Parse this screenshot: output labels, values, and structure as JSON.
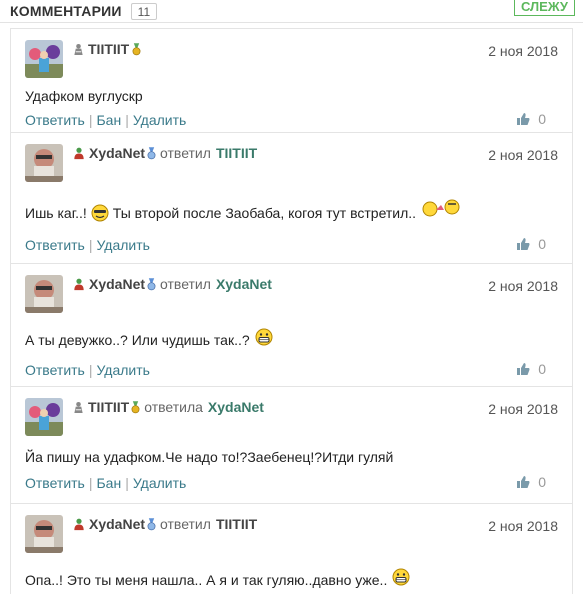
{
  "header": {
    "title": "КОММЕНТАРИИ",
    "count": "11",
    "follow_label": "СЛЕЖУ"
  },
  "actions": {
    "reply": "Ответить",
    "ban": "Бан",
    "delete": "Удалить",
    "sep": "|"
  },
  "colors": {
    "link": "#3a7a8a",
    "green": "#5cb85c",
    "bronze": "#d4a017",
    "blue": "#5b8fd6"
  },
  "comments": [
    {
      "user": "TIITIIT",
      "verb": "",
      "target": "",
      "date": "2 ноя 2018",
      "text": "Удафком вуглускр",
      "votes": "0",
      "has_ban": true
    },
    {
      "user": "XydaNet",
      "verb": "ответил",
      "target": "TIITIIT",
      "date": "2 ноя 2018",
      "text_before": "Ишь каг..!",
      "text_after": "Ты второй после Заобаба, когоя тут встретил..",
      "votes": "0",
      "has_ban": false
    },
    {
      "user": "XydaNet",
      "verb": "ответил",
      "target": "XydaNet",
      "date": "2 ноя 2018",
      "text": "А ты девужко..? Или чудишь так..?",
      "votes": "0",
      "has_ban": false
    },
    {
      "user": "TIITIIT",
      "verb": "ответила",
      "target": "XydaNet",
      "date": "2 ноя 2018",
      "text": "Йа пишу на удафком.Че надо то!?Заебенец!?Итди гуляй",
      "votes": "0",
      "has_ban": true
    },
    {
      "user": "XydaNet",
      "verb": "ответил",
      "target": "TIITIIT",
      "date": "2 ноя 2018",
      "text": "Опа..! Это ты меня нашла.. А я и так гуляю..давно уже..",
      "votes": "",
      "has_ban": false
    }
  ]
}
